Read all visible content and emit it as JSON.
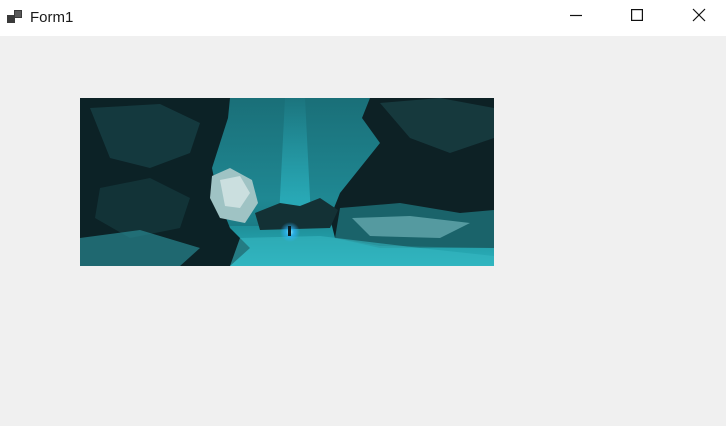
{
  "window": {
    "title": "Form1",
    "icons": {
      "app": "app-icon",
      "minimize": "minimize-icon",
      "maximize": "maximize-icon",
      "close": "close-icon"
    }
  },
  "colors": {
    "titlebar_bg": "#ffffff",
    "client_bg": "#f0f0f0",
    "cave_sky": "#1d7d88",
    "cave_rock": "#0b1d20",
    "cave_snow": "#2aa3ad",
    "light_beam": "#35d6e6"
  },
  "picture": {
    "content": "cave-landscape-image"
  }
}
